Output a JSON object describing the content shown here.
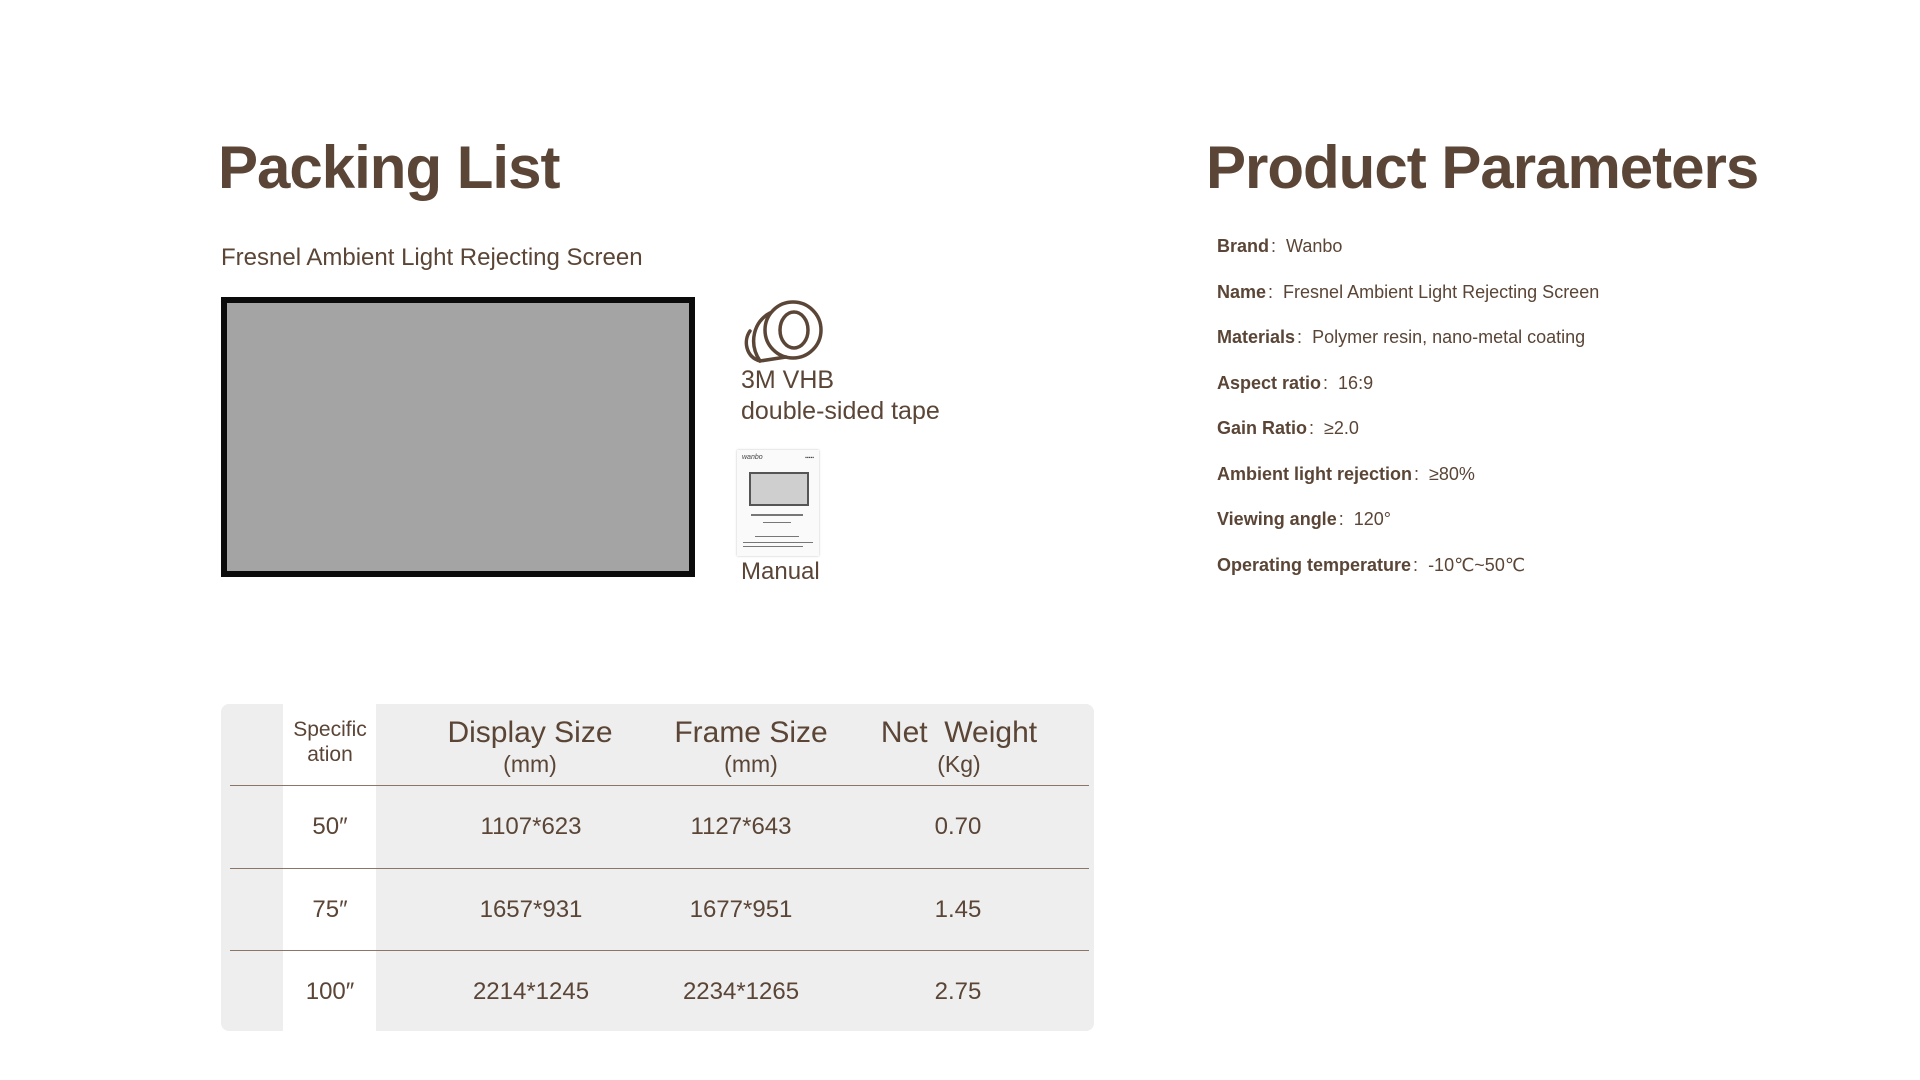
{
  "packing_list": {
    "title": "Packing List",
    "screen_label": "Fresnel Ambient Light Rejecting Screen",
    "tape_label_line1": "3M VHB",
    "tape_label_line2": "double-sided tape",
    "manual_label": "Manual",
    "manual_brand": "wanbo"
  },
  "product_parameters": {
    "title": "Product Parameters",
    "separator": ":",
    "items": [
      {
        "label": "Brand",
        "value": "Wanbo"
      },
      {
        "label": "Name",
        "value": "Fresnel Ambient Light Rejecting Screen"
      },
      {
        "label": "Materials",
        "value": "Polymer resin, nano-metal coating"
      },
      {
        "label": "Aspect ratio",
        "value": "16:9"
      },
      {
        "label": "Gain Ratio",
        "value": "≥2.0"
      },
      {
        "label": "Ambient light rejection",
        "value": "≥80%"
      },
      {
        "label": "Viewing angle",
        "value": "120°"
      },
      {
        "label": "Operating temperature",
        "value": "-10℃~50℃"
      }
    ]
  },
  "spec_table": {
    "headers": {
      "spec_line1": "Specific",
      "spec_line2": "ation",
      "display_size": "Display Size",
      "display_unit": "(mm)",
      "frame_size": "Frame Size",
      "frame_unit": "(mm)",
      "net_weight": "Net  Weight",
      "weight_unit": "(Kg)"
    },
    "rows": [
      {
        "spec": "50″",
        "display": "1107*623",
        "frame": "1127*643",
        "weight": "0.70"
      },
      {
        "spec": "75″",
        "display": "1657*931",
        "frame": "1677*951",
        "weight": "1.45"
      },
      {
        "spec": "100″",
        "display": "2214*1245",
        "frame": "2234*1265",
        "weight": "2.75"
      }
    ]
  }
}
